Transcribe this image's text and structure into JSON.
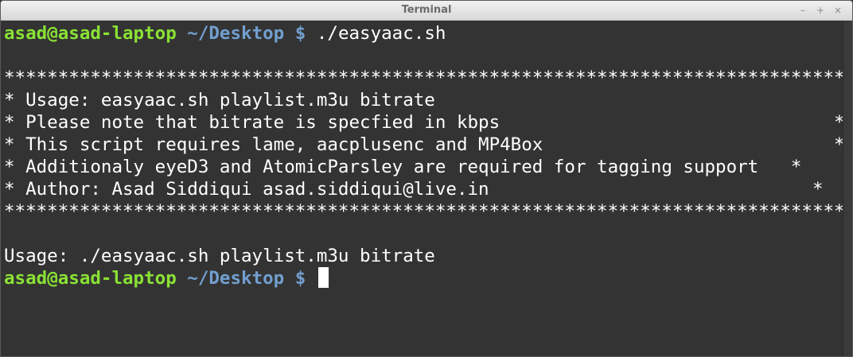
{
  "window": {
    "title": "Terminal",
    "controls": {
      "minimize": "–",
      "maximize": "+",
      "close": "×"
    }
  },
  "colors": {
    "prompt_user": "#8ae234",
    "prompt_path": "#729fcf",
    "foreground": "#ffffff",
    "background": "#333333"
  },
  "terminal": {
    "prompt1": {
      "user": "asad@asad-laptop",
      "path": " ~/Desktop $",
      "command": " ./easyaac.sh"
    },
    "output": [
      "******************************************************************************",
      "* Usage: easyaac.sh playlist.m3u bitrate                                      *",
      "* Please note that bitrate is specfied in kbps                               *",
      "* This script requires lame, aacplusenc and MP4Box                           *",
      "* Additionaly eyeD3 and AtomicParsley are required for tagging support   *",
      "* Author: Asad Siddiqui asad.siddiqui@live.in                              *",
      "******************************************************************************",
      "",
      "Usage: ./easyaac.sh playlist.m3u bitrate"
    ],
    "prompt2": {
      "user": "asad@asad-laptop",
      "path": " ~/Desktop $",
      "command": " "
    }
  }
}
